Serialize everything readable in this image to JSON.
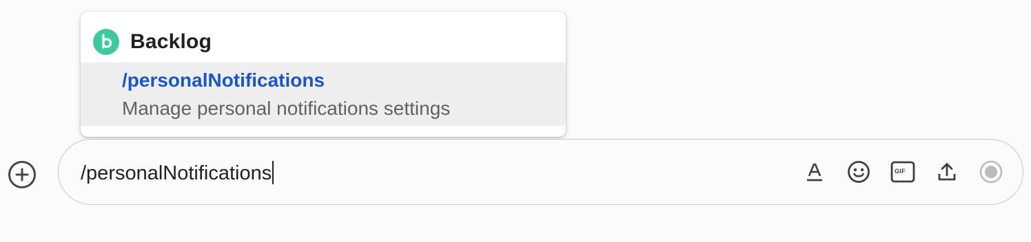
{
  "popup": {
    "app_name": "Backlog",
    "app_logo_icon": "backlog-logo",
    "accent_color": "#3ec99c",
    "command": {
      "name": "/personalNotifications",
      "description": "Manage personal notifications settings",
      "name_color": "#1a57c4"
    }
  },
  "composer": {
    "value": "/personalNotifications",
    "add_button_icon": "plus-circle-icon",
    "tools": [
      {
        "name": "format-text-icon"
      },
      {
        "name": "emoji-icon"
      },
      {
        "name": "gif-icon",
        "label": "GIF"
      },
      {
        "name": "upload-icon"
      },
      {
        "name": "record-icon"
      }
    ]
  }
}
